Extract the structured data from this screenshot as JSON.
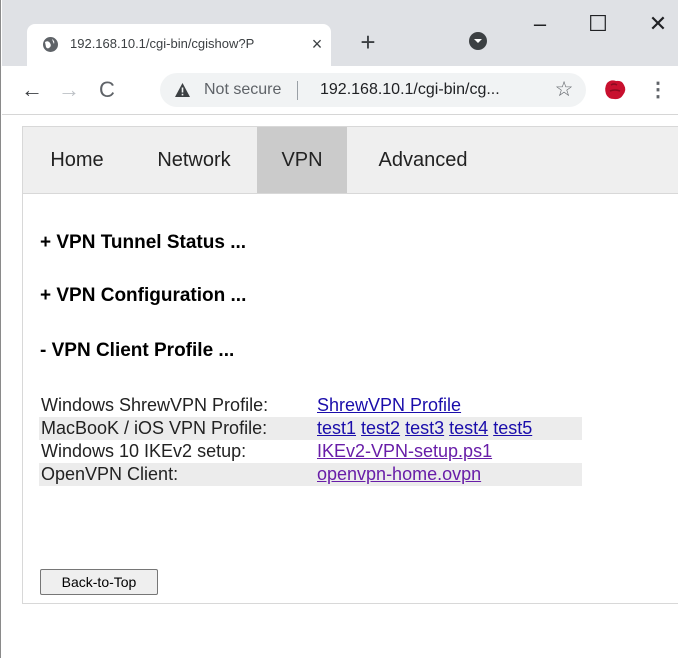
{
  "browser": {
    "tab": {
      "title": "192.168.10.1/cgi-bin/cgishow?P",
      "close_glyph": "×",
      "favicon": "globe-icon"
    },
    "new_tab_glyph": "+",
    "window_controls": {
      "minimize": "–",
      "maximize": "☐",
      "close": "✕"
    },
    "toolbar": {
      "back": "←",
      "forward": "→",
      "reload": "C",
      "security_text": "Not secure",
      "url": "192.168.10.1/cgi-bin/cg...",
      "bookmark_glyph": "☆",
      "menu_glyph": "⋮"
    },
    "colors": {
      "tabstrip": "#dfe1e5",
      "omnibox": "#f1f3f4",
      "extension": "#c8102e"
    }
  },
  "page": {
    "nav": {
      "items": [
        "Home",
        "Network",
        "VPN",
        "Advanced"
      ],
      "active": "VPN"
    },
    "sections": [
      "+ VPN Tunnel Status ...",
      "+ VPN Configuration ...",
      "- VPN Client Profile ..."
    ],
    "profiles": {
      "rows": [
        {
          "label": "Windows ShrewVPN Profile:",
          "links": [
            "ShrewVPN Profile"
          ]
        },
        {
          "label": "MacBooK / iOS VPN Profile:",
          "links": [
            "test1",
            "test2",
            "test3",
            "test4",
            "test5"
          ]
        },
        {
          "label": "Windows 10 IKEv2 setup:",
          "links": [
            "IKEv2-VPN-setup.ps1"
          ]
        },
        {
          "label": "OpenVPN Client:",
          "links": [
            "openvpn-home.ovpn"
          ]
        }
      ]
    },
    "back_to_top": "Back-to-Top",
    "colors": {
      "navbar": "#efefef",
      "nav_active": "#cbcbcb",
      "link": "#1a0dab",
      "visited_link": "#681da8"
    }
  }
}
